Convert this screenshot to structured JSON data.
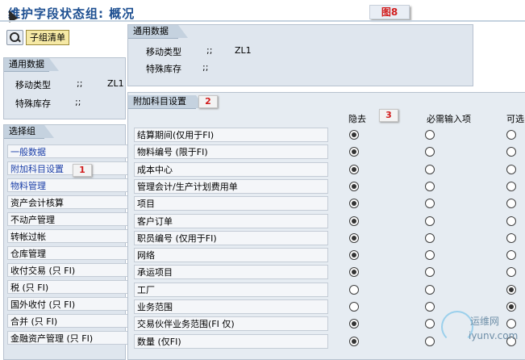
{
  "title": "维护字段状态组: 概况",
  "figure_label": "图8",
  "toolbar": {
    "subgroup_button": "子组清单"
  },
  "general_top": {
    "header": "通用数据",
    "rows": [
      {
        "label": "移动类型",
        "sep": ";;",
        "value": "ZL1"
      },
      {
        "label": "特殊库存",
        "sep": ";;",
        "value": ""
      }
    ]
  },
  "general_left": {
    "header": "通用数据",
    "rows": [
      {
        "label": "移动类型",
        "sep": ";;",
        "value": "ZL1"
      },
      {
        "label": "特殊库存",
        "sep": ";;",
        "value": ""
      }
    ]
  },
  "select_group": {
    "header": "选择组",
    "items": [
      {
        "label": "一般数据",
        "link": true
      },
      {
        "label": "附加科目设置",
        "link": true
      },
      {
        "label": "物料管理",
        "link": true
      },
      {
        "label": "资产会计核算",
        "link": false
      },
      {
        "label": "不动产管理",
        "link": false
      },
      {
        "label": "转帐过帐",
        "link": false
      },
      {
        "label": "仓库管理",
        "link": false
      },
      {
        "label": "收付交易 (只 FI)",
        "link": false
      },
      {
        "label": "税              (只 FI)",
        "link": false
      },
      {
        "label": "国外收付          (只 FI)",
        "link": false
      },
      {
        "label": "合并                  (只 FI)",
        "link": false
      },
      {
        "label": "金融资产管理          (只 FI)",
        "link": false
      }
    ]
  },
  "additional": {
    "header": "附加科目设置",
    "columns": [
      "隐去",
      "必需输入项",
      "可选"
    ],
    "rows": [
      {
        "label": "结算期间(仅用于FI)",
        "selected": 0
      },
      {
        "label": "物料编号     (限于FI)",
        "selected": 0
      },
      {
        "label": "成本中心",
        "selected": 0
      },
      {
        "label": "管理会计/生产计划费用单",
        "selected": 0
      },
      {
        "label": "项目",
        "selected": 0
      },
      {
        "label": "客户订单",
        "selected": 0
      },
      {
        "label": "职员编号 (仅用于FI)",
        "selected": 0
      },
      {
        "label": "网络",
        "selected": 0
      },
      {
        "label": "承运项目",
        "selected": 0
      },
      {
        "label": "工厂",
        "selected": 2
      },
      {
        "label": "业务范围",
        "selected": 2
      },
      {
        "label": "交易伙伴业务范围(FI 仅)",
        "selected": 0
      },
      {
        "label": "数量       (仅FI)",
        "selected": 0
      }
    ]
  },
  "markers": {
    "m1": "1",
    "m2": "2",
    "m3": "3"
  },
  "watermark": {
    "line1": "运维网",
    "line2": "iyunv.com"
  }
}
